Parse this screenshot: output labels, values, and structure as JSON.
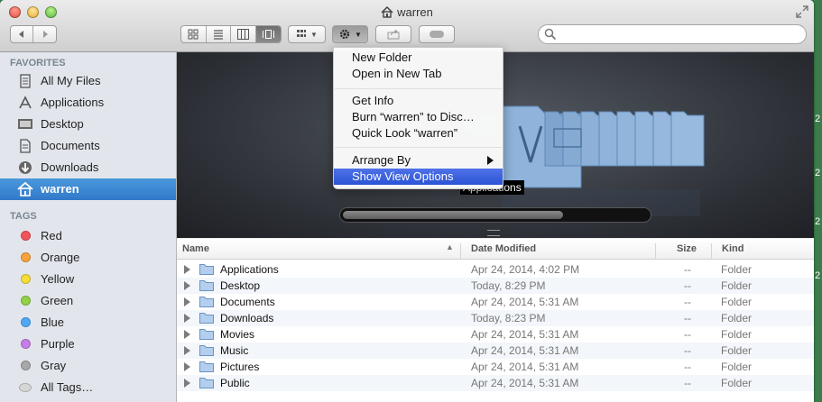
{
  "window": {
    "title": "warren"
  },
  "toolbar": {
    "view_modes": [
      "icon",
      "list",
      "column",
      "coverflow"
    ],
    "active_view": "coverflow",
    "search": {
      "value": "",
      "placeholder": ""
    }
  },
  "sidebar": {
    "favorites_header": "FAVORITES",
    "favorites": [
      {
        "label": "All My Files",
        "icon": "all-files-icon"
      },
      {
        "label": "Applications",
        "icon": "applications-icon"
      },
      {
        "label": "Desktop",
        "icon": "desktop-icon"
      },
      {
        "label": "Documents",
        "icon": "documents-icon"
      },
      {
        "label": "Downloads",
        "icon": "downloads-icon"
      },
      {
        "label": "warren",
        "icon": "home-icon",
        "selected": true
      }
    ],
    "tags_header": "TAGS",
    "tags": [
      {
        "label": "Red",
        "color": "#f2545b"
      },
      {
        "label": "Orange",
        "color": "#f8a33a"
      },
      {
        "label": "Yellow",
        "color": "#f5dc3b"
      },
      {
        "label": "Green",
        "color": "#92d145"
      },
      {
        "label": "Blue",
        "color": "#4ea8f5"
      },
      {
        "label": "Purple",
        "color": "#c77de6"
      },
      {
        "label": "Gray",
        "color": "#a8a8a8"
      },
      {
        "label": "All Tags…",
        "color": "#d6d6d6"
      }
    ]
  },
  "preview": {
    "label": "Applications"
  },
  "list": {
    "columns": {
      "name": "Name",
      "date": "Date Modified",
      "size": "Size",
      "kind": "Kind"
    },
    "rows": [
      {
        "name": "Applications",
        "date": "Apr 24, 2014, 4:02 PM",
        "size": "--",
        "kind": "Folder"
      },
      {
        "name": "Desktop",
        "date": "Today, 8:29 PM",
        "size": "--",
        "kind": "Folder"
      },
      {
        "name": "Documents",
        "date": "Apr 24, 2014, 5:31 AM",
        "size": "--",
        "kind": "Folder"
      },
      {
        "name": "Downloads",
        "date": "Today, 8:23 PM",
        "size": "--",
        "kind": "Folder"
      },
      {
        "name": "Movies",
        "date": "Apr 24, 2014, 5:31 AM",
        "size": "--",
        "kind": "Folder"
      },
      {
        "name": "Music",
        "date": "Apr 24, 2014, 5:31 AM",
        "size": "--",
        "kind": "Folder"
      },
      {
        "name": "Pictures",
        "date": "Apr 24, 2014, 5:31 AM",
        "size": "--",
        "kind": "Folder"
      },
      {
        "name": "Public",
        "date": "Apr 24, 2014, 5:31 AM",
        "size": "--",
        "kind": "Folder"
      }
    ]
  },
  "action_menu": {
    "items": [
      {
        "label": "New Folder"
      },
      {
        "label": "Open in New Tab"
      },
      {
        "label": "Get Info"
      },
      {
        "label": "Burn “warren” to Disc…"
      },
      {
        "label": "Quick Look “warren”"
      },
      {
        "label": "Arrange By"
      },
      {
        "label": "Show View Options",
        "highlighted": true
      }
    ]
  },
  "desktop_edge": [
    "2",
    "2",
    "2",
    "2"
  ]
}
